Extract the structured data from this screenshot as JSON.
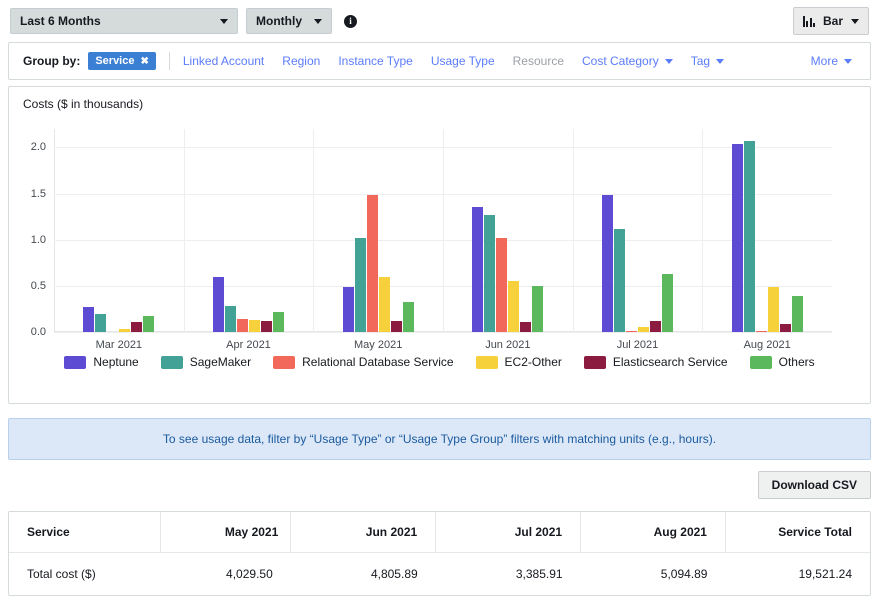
{
  "toolbar": {
    "date_range": "Last 6 Months",
    "granularity": "Monthly",
    "info_icon": "info-icon",
    "chart_type": "Bar",
    "chart_type_icon": "bar-chart-icon"
  },
  "group_by": {
    "label": "Group by:",
    "selected_pill": "Service",
    "pill_remove_icon": "close-icon",
    "options": [
      {
        "label": "Linked Account",
        "disabled": false,
        "has_caret": false
      },
      {
        "label": "Region",
        "disabled": false,
        "has_caret": false
      },
      {
        "label": "Instance Type",
        "disabled": false,
        "has_caret": false
      },
      {
        "label": "Usage Type",
        "disabled": false,
        "has_caret": false
      },
      {
        "label": "Resource",
        "disabled": true,
        "has_caret": false
      },
      {
        "label": "Cost Category",
        "disabled": false,
        "has_caret": true
      },
      {
        "label": "Tag",
        "disabled": false,
        "has_caret": true
      }
    ],
    "more_label": "More"
  },
  "chart_data": {
    "type": "bar",
    "title": "Costs ($ in thousands)",
    "xlabel": "",
    "ylabel": "Costs ($ in thousands)",
    "ylim": [
      0.0,
      2.2
    ],
    "yticks": [
      0.0,
      0.5,
      1.0,
      1.5,
      2.0
    ],
    "ytick_labels": [
      "0.0",
      "0.5",
      "1.0",
      "1.5",
      "2.0"
    ],
    "grid": true,
    "legend_position": "bottom",
    "categories": [
      "Mar 2021",
      "Apr 2021",
      "May 2021",
      "Jun 2021",
      "Jul 2021",
      "Aug 2021"
    ],
    "series": [
      {
        "name": "Neptune",
        "color": "#5d4bd4",
        "values": [
          0.27,
          0.6,
          0.49,
          1.36,
          1.48,
          2.04
        ]
      },
      {
        "name": "SageMaker",
        "color": "#43a296",
        "values": [
          0.2,
          0.28,
          1.02,
          1.27,
          1.12,
          2.07
        ]
      },
      {
        "name": "Relational Database Service",
        "color": "#f2695c",
        "values": [
          0.0,
          0.14,
          1.48,
          1.02,
          0.01,
          0.01
        ]
      },
      {
        "name": "EC2-Other",
        "color": "#f6d13c",
        "values": [
          0.03,
          0.13,
          0.6,
          0.55,
          0.05,
          0.49
        ]
      },
      {
        "name": "Elasticsearch Service",
        "color": "#8c1b40",
        "values": [
          0.11,
          0.12,
          0.12,
          0.11,
          0.12,
          0.09
        ]
      },
      {
        "name": "Others",
        "color": "#5cb85c",
        "values": [
          0.17,
          0.22,
          0.33,
          0.5,
          0.63,
          0.39
        ]
      }
    ]
  },
  "banner": {
    "text": "To see usage data, filter by “Usage Type” or “Usage Type Group” filters with matching units (e.g., hours)."
  },
  "download": {
    "label": "Download CSV"
  },
  "table": {
    "columns": [
      "Service",
      "May 2021",
      "Jun 2021",
      "Jul 2021",
      "Aug 2021",
      "Service Total"
    ],
    "rows": [
      [
        "Total cost ($)",
        "4,029.50",
        "4,805.89",
        "3,385.91",
        "5,094.89",
        "19,521.24"
      ]
    ]
  }
}
